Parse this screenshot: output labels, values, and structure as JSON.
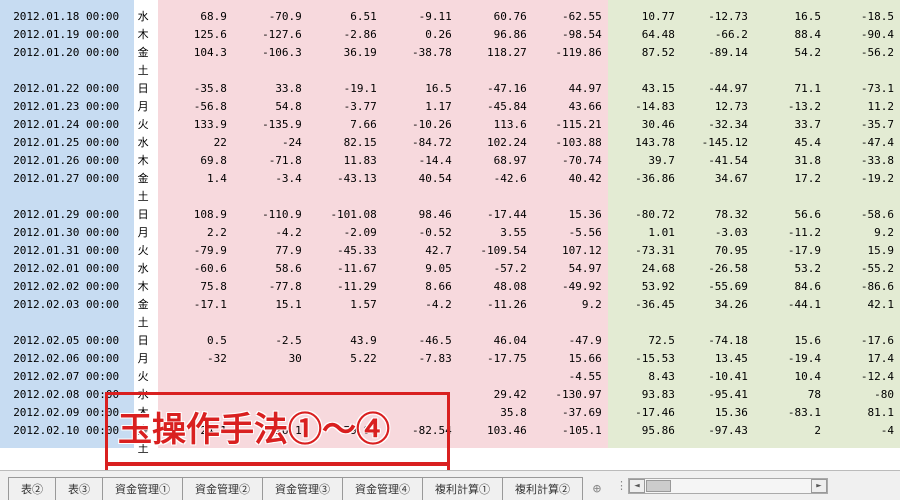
{
  "rows": [
    {
      "date": "",
      "dow": "",
      "a": "",
      "b": "",
      "c": "",
      "d": "",
      "e": "",
      "f": "",
      "g": "",
      "h": "",
      "i": "",
      "j": "",
      "blankdate": true
    },
    {
      "date": "2012.01.18 00:00",
      "dow": "水",
      "a": "68.9",
      "b": "-70.9",
      "c": "6.51",
      "d": "-9.11",
      "e": "60.76",
      "f": "-62.55",
      "g": "10.77",
      "h": "-12.73",
      "i": "16.5",
      "j": "-18.5"
    },
    {
      "date": "2012.01.19 00:00",
      "dow": "木",
      "a": "125.6",
      "b": "-127.6",
      "c": "-2.86",
      "d": "0.26",
      "e": "96.86",
      "f": "-98.54",
      "g": "64.48",
      "h": "-66.2",
      "i": "88.4",
      "j": "-90.4"
    },
    {
      "date": "2012.01.20 00:00",
      "dow": "金",
      "a": "104.3",
      "b": "-106.3",
      "c": "36.19",
      "d": "-38.78",
      "e": "118.27",
      "f": "-119.86",
      "g": "87.52",
      "h": "-89.14",
      "i": "54.2",
      "j": "-56.2"
    },
    {
      "date": "",
      "dow": "土",
      "blank": true
    },
    {
      "date": "2012.01.22 00:00",
      "dow": "日",
      "a": "-35.8",
      "b": "33.8",
      "c": "-19.1",
      "d": "16.5",
      "e": "-47.16",
      "f": "44.97",
      "g": "43.15",
      "h": "-44.97",
      "i": "71.1",
      "j": "-73.1"
    },
    {
      "date": "2012.01.23 00:00",
      "dow": "月",
      "a": "-56.8",
      "b": "54.8",
      "c": "-3.77",
      "d": "1.17",
      "e": "-45.84",
      "f": "43.66",
      "g": "-14.83",
      "h": "12.73",
      "i": "-13.2",
      "j": "11.2"
    },
    {
      "date": "2012.01.24 00:00",
      "dow": "火",
      "a": "133.9",
      "b": "-135.9",
      "c": "7.66",
      "d": "-10.26",
      "e": "113.6",
      "f": "-115.21",
      "g": "30.46",
      "h": "-32.34",
      "i": "33.7",
      "j": "-35.7"
    },
    {
      "date": "2012.01.25 00:00",
      "dow": "水",
      "a": "22",
      "b": "-24",
      "c": "82.15",
      "d": "-84.72",
      "e": "102.24",
      "f": "-103.88",
      "g": "143.78",
      "h": "-145.12",
      "i": "45.4",
      "j": "-47.4"
    },
    {
      "date": "2012.01.26 00:00",
      "dow": "木",
      "a": "69.8",
      "b": "-71.8",
      "c": "11.83",
      "d": "-14.4",
      "e": "68.97",
      "f": "-70.74",
      "g": "39.7",
      "h": "-41.54",
      "i": "31.8",
      "j": "-33.8"
    },
    {
      "date": "2012.01.27 00:00",
      "dow": "金",
      "a": "1.4",
      "b": "-3.4",
      "c": "-43.13",
      "d": "40.54",
      "e": "-42.6",
      "f": "40.42",
      "g": "-36.86",
      "h": "34.67",
      "i": "17.2",
      "j": "-19.2"
    },
    {
      "date": "",
      "dow": "土",
      "blank": true
    },
    {
      "date": "2012.01.29 00:00",
      "dow": "日",
      "a": "108.9",
      "b": "-110.9",
      "c": "-101.08",
      "d": "98.46",
      "e": "-17.44",
      "f": "15.36",
      "g": "-80.72",
      "h": "78.32",
      "i": "56.6",
      "j": "-58.6"
    },
    {
      "date": "2012.01.30 00:00",
      "dow": "月",
      "a": "2.2",
      "b": "-4.2",
      "c": "-2.09",
      "d": "-0.52",
      "e": "3.55",
      "f": "-5.56",
      "g": "1.01",
      "h": "-3.03",
      "i": "-11.2",
      "j": "9.2"
    },
    {
      "date": "2012.01.31 00:00",
      "dow": "火",
      "a": "-79.9",
      "b": "77.9",
      "c": "-45.33",
      "d": "42.7",
      "e": "-109.54",
      "f": "107.12",
      "g": "-73.31",
      "h": "70.95",
      "i": "-17.9",
      "j": "15.9"
    },
    {
      "date": "2012.02.01 00:00",
      "dow": "水",
      "a": "-60.6",
      "b": "58.6",
      "c": "-11.67",
      "d": "9.05",
      "e": "-57.2",
      "f": "54.97",
      "g": "24.68",
      "h": "-26.58",
      "i": "53.2",
      "j": "-55.2"
    },
    {
      "date": "2012.02.02 00:00",
      "dow": "木",
      "a": "75.8",
      "b": "-77.8",
      "c": "-11.29",
      "d": "8.66",
      "e": "48.08",
      "f": "-49.92",
      "g": "53.92",
      "h": "-55.69",
      "i": "84.6",
      "j": "-86.6"
    },
    {
      "date": "2012.02.03 00:00",
      "dow": "金",
      "a": "-17.1",
      "b": "15.1",
      "c": "1.57",
      "d": "-4.2",
      "e": "-11.26",
      "f": "9.2",
      "g": "-36.45",
      "h": "34.26",
      "i": "-44.1",
      "j": "42.1"
    },
    {
      "date": "",
      "dow": "土",
      "blank": true
    },
    {
      "date": "2012.02.05 00:00",
      "dow": "日",
      "a": "0.5",
      "b": "-2.5",
      "c": "43.9",
      "d": "-46.5",
      "e": "46.04",
      "f": "-47.9",
      "g": "72.5",
      "h": "-74.18",
      "i": "15.6",
      "j": "-17.6"
    },
    {
      "date": "2012.02.06 00:00",
      "dow": "月",
      "a": "-32",
      "b": "30",
      "c": "5.22",
      "d": "-7.83",
      "e": "-17.75",
      "f": "15.66",
      "g": "-15.53",
      "h": "13.45",
      "i": "-19.4",
      "j": "17.4"
    },
    {
      "date": "2012.02.07 00:00",
      "dow": "火",
      "a": "",
      "b": "",
      "c": "",
      "d": "",
      "e": "",
      "f": "-4.55",
      "g": "8.43",
      "h": "-10.41",
      "i": "10.4",
      "j": "-12.4"
    },
    {
      "date": "2012.02.08 00:00",
      "dow": "水",
      "a": "",
      "b": "",
      "c": "",
      "d": "",
      "e": "29.42",
      "f": "-130.97",
      "g": "93.83",
      "h": "-95.41",
      "i": "78",
      "j": "-80"
    },
    {
      "date": "2012.02.09 00:00",
      "dow": "木",
      "a": "",
      "b": "",
      "c": "",
      "d": "",
      "e": "35.8",
      "f": "-37.69",
      "g": "-17.46",
      "h": "15.36",
      "i": "-83.1",
      "j": "81.1"
    },
    {
      "date": "2012.02.10 00:00",
      "dow": "金",
      "a": "24.1",
      "b": "-26.1",
      "c": "79.97",
      "d": "-82.54",
      "e": "103.46",
      "f": "-105.1",
      "g": "95.86",
      "h": "-97.43",
      "i": "2",
      "j": "-4"
    },
    {
      "date": "",
      "dow": "土",
      "blank": true,
      "last": true
    }
  ],
  "tabs": [
    {
      "label": "表②",
      "name": "tab-sheet-2"
    },
    {
      "label": "表③",
      "name": "tab-sheet-3"
    },
    {
      "label": "資金管理①",
      "name": "tab-shikin-1",
      "group": true
    },
    {
      "label": "資金管理②",
      "name": "tab-shikin-2",
      "group": true
    },
    {
      "label": "資金管理③",
      "name": "tab-shikin-3",
      "group": true
    },
    {
      "label": "資金管理④",
      "name": "tab-shikin-4",
      "group": true
    },
    {
      "label": "複利計算①",
      "name": "tab-fukuri-1"
    },
    {
      "label": "複利計算②",
      "name": "tab-fukuri-2"
    }
  ],
  "overlay": {
    "text": "玉操作手法①～④"
  }
}
